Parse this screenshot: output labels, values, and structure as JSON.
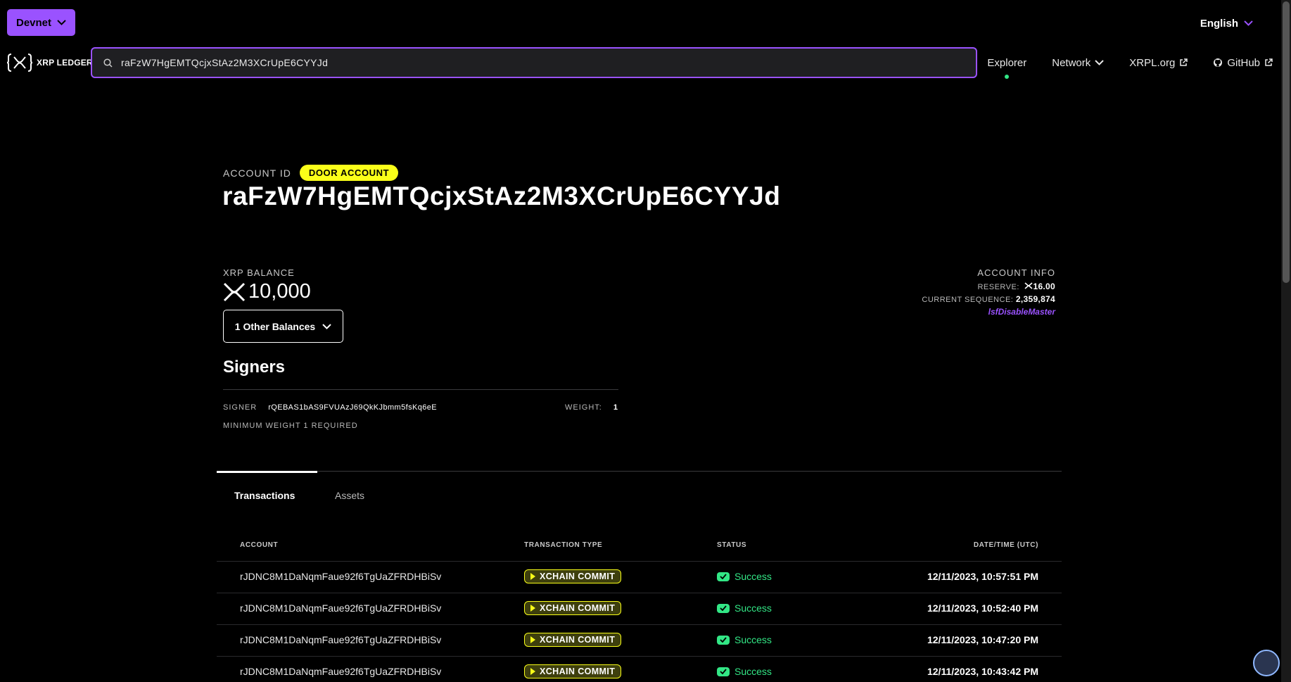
{
  "topbar": {
    "network_label": "Devnet",
    "language_label": "English"
  },
  "logo": {
    "text": "XRP LEDGER"
  },
  "search": {
    "value": "raFzW7HgEMTQcjxStAz2M3XCrUpE6CYYJd"
  },
  "nav": {
    "explorer": "Explorer",
    "network": "Network",
    "xrpl": "XRPL.org",
    "github": "GitHub"
  },
  "account": {
    "label": "ACCOUNT ID",
    "badge": "DOOR ACCOUNT",
    "id": "raFzW7HgEMTQcjxStAz2M3XCrUpE6CYYJd"
  },
  "balance": {
    "label": "XRP BALANCE",
    "value": "10,000",
    "other_balances": "1 Other Balances"
  },
  "account_info": {
    "title": "ACCOUNT INFO",
    "reserve_label": "RESERVE:",
    "reserve_value": "16.00",
    "sequence_label": "CURRENT SEQUENCE:",
    "sequence_value": "2,359,874",
    "flag": "lsfDisableMaster"
  },
  "signers": {
    "title": "Signers",
    "signer_label": "SIGNER",
    "signer_address": "rQEBAS1bAS9FVUAzJ69QkKJbmm5fsKq6eE",
    "weight_label": "WEIGHT:",
    "weight_value": "1",
    "min_weight": "MINIMUM WEIGHT 1 REQUIRED"
  },
  "tabs": {
    "transactions": "Transactions",
    "assets": "Assets"
  },
  "table": {
    "headers": {
      "account": "ACCOUNT",
      "type": "TRANSACTION TYPE",
      "status": "STATUS",
      "date": "DATE/TIME (UTC)"
    },
    "rows": [
      {
        "account": "rJDNC8M1DaNqmFaue92f6TgUaZFRDHBiSv",
        "type": "XCHAIN COMMIT",
        "status": "Success",
        "date": "12/11/2023, 10:57:51 PM"
      },
      {
        "account": "rJDNC8M1DaNqmFaue92f6TgUaZFRDHBiSv",
        "type": "XCHAIN COMMIT",
        "status": "Success",
        "date": "12/11/2023, 10:52:40 PM"
      },
      {
        "account": "rJDNC8M1DaNqmFaue92f6TgUaZFRDHBiSv",
        "type": "XCHAIN COMMIT",
        "status": "Success",
        "date": "12/11/2023, 10:47:20 PM"
      },
      {
        "account": "rJDNC8M1DaNqmFaue92f6TgUaZFRDHBiSv",
        "type": "XCHAIN COMMIT",
        "status": "Success",
        "date": "12/11/2023, 10:43:42 PM"
      }
    ]
  },
  "colors": {
    "accent": "#9a52ff",
    "badge": "#faff19",
    "success": "#32e685",
    "background": "#000000"
  }
}
